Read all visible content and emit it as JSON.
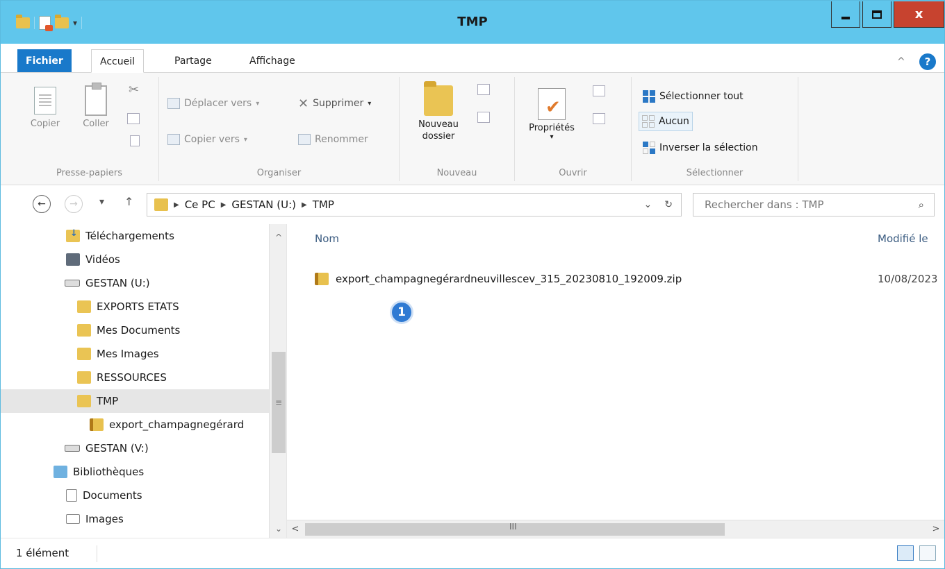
{
  "window": {
    "title": "TMP"
  },
  "ribbon_tabs": {
    "file": "Fichier",
    "home": "Accueil",
    "share": "Partage",
    "view": "Affichage"
  },
  "ribbon": {
    "clipboard": {
      "label": "Presse-papiers",
      "copy": "Copier",
      "paste": "Coller"
    },
    "organize": {
      "label": "Organiser",
      "move_to": "Déplacer vers",
      "copy_to": "Copier vers",
      "delete": "Supprimer",
      "rename": "Renommer"
    },
    "new": {
      "label": "Nouveau",
      "new_folder": "Nouveau dossier"
    },
    "open": {
      "label": "Ouvrir",
      "properties": "Propriétés"
    },
    "select": {
      "label": "Sélectionner",
      "select_all": "Sélectionner tout",
      "none": "Aucun",
      "invert": "Inverser la sélection"
    }
  },
  "address": {
    "crumbs": [
      "Ce PC",
      "GESTAN (U:)",
      "TMP"
    ]
  },
  "search": {
    "placeholder": "Rechercher dans : TMP"
  },
  "tree": [
    {
      "label": "Téléchargements",
      "type": "downloads"
    },
    {
      "label": "Vidéos",
      "type": "videos"
    },
    {
      "label": "GESTAN (U:)",
      "type": "drive"
    },
    {
      "label": "EXPORTS ETATS",
      "type": "folder"
    },
    {
      "label": "Mes Documents",
      "type": "folder"
    },
    {
      "label": "Mes Images",
      "type": "folder"
    },
    {
      "label": "RESSOURCES",
      "type": "folder"
    },
    {
      "label": "TMP",
      "type": "folder",
      "selected": true
    },
    {
      "label": "export_champagnegérard",
      "type": "zip"
    },
    {
      "label": "GESTAN (V:)",
      "type": "drive"
    },
    {
      "label": "Bibliothèques",
      "type": "library"
    },
    {
      "label": "Documents",
      "type": "doc"
    },
    {
      "label": "Images",
      "type": "img"
    }
  ],
  "columns": {
    "name": "Nom",
    "modified": "Modifié le"
  },
  "files": [
    {
      "name": "export_champagnegérardneuvillescev_315_20230810_192009.zip",
      "modified": "10/08/2023"
    }
  ],
  "annotation": {
    "badge": "1"
  },
  "status": {
    "count": "1 élément"
  },
  "colors": {
    "titlebar": "#60c6ec",
    "close": "#c7432f",
    "file_tab": "#1979ca",
    "folder": "#eac454"
  }
}
